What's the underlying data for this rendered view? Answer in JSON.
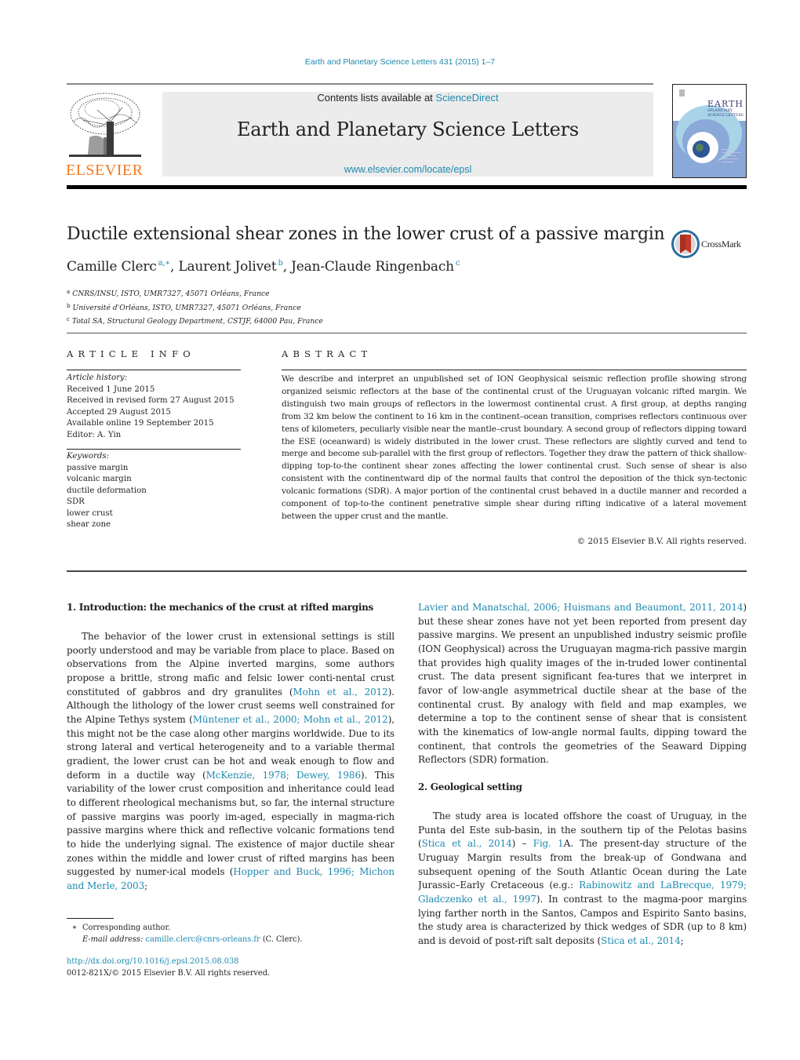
{
  "header": {
    "running_head": "Earth and Planetary Science Letters 431 (2015) 1–7",
    "contents_prefix": "Contents lists available at ",
    "contents_link": "ScienceDirect",
    "journal_title": "Earth and Planetary Science Letters",
    "journal_url": "www.elsevier.com/locate/epsl",
    "publisher_wordmark": "ELSEVIER",
    "cover_title_lines": [
      "EARTH",
      "SPLANETARY",
      "SCIENCE LETTERS"
    ]
  },
  "article": {
    "title": "Ductile extensional shear zones in the lower crust of a passive margin",
    "crossmark_label": "CrossMark",
    "authors": [
      {
        "name": "Camille Clerc",
        "sup": "a,∗"
      },
      {
        "name": "Laurent Jolivet",
        "sup": "b"
      },
      {
        "name": "Jean-Claude Ringenbach",
        "sup": "c"
      }
    ],
    "author_separator": ", ",
    "affiliations": [
      {
        "key": "a",
        "text": "CNRS/INSU, ISTO, UMR7327, 45071 Orléans, France"
      },
      {
        "key": "b",
        "text": "Université d'Orléans, ISTO, UMR7327, 45071 Orléans, France"
      },
      {
        "key": "c",
        "text": "Total SA, Structural Geology Department, CSTJF, 64000 Pau, France"
      }
    ]
  },
  "article_info": {
    "heading": "ARTICLE INFO",
    "history_label": "Article history:",
    "history": [
      "Received 1 June 2015",
      "Received in revised form 27 August 2015",
      "Accepted 29 August 2015",
      "Available online 19 September 2015",
      "Editor: A. Yin"
    ],
    "keywords_label": "Keywords:",
    "keywords": [
      "passive margin",
      "volcanic margin",
      "ductile deformation",
      "SDR",
      "lower crust",
      "shear zone"
    ]
  },
  "abstract": {
    "heading": "ABSTRACT",
    "text": "We describe and interpret an unpublished set of ION Geophysical seismic reflection profile showing strong organized seismic reflectors at the base of the continental crust of the Uruguayan volcanic rifted margin. We distinguish two main groups of reflectors in the lowermost continental crust. A first group, at depths ranging from 32 km below the continent to 16 km in the continent–ocean transition, comprises reflectors continuous over tens of kilometers, peculiarly visible near the mantle–crust boundary. A second group of reflectors dipping toward the ESE (oceanward) is widely distributed in the lower crust. These reflectors are slightly curved and tend to merge and become sub-parallel with the first group of reflectors. Together they draw the pattern of thick shallow-dipping top-to-the continent shear zones affecting the lower continental crust. Such sense of shear is also consistent with the continentward dip of the normal faults that control the deposition of the thick syn-tectonic volcanic formations (SDR). A major portion of the continental crust behaved in a ductile manner and recorded a component of top-to-the continent penetrative simple shear during rifting indicative of a lateral movement between the upper crust and the mantle.",
    "copyright": "© 2015 Elsevier B.V. All rights reserved."
  },
  "body": {
    "section1": {
      "heading": "1.  Introduction: the mechanics of the crust at rifted margins",
      "p1": [
        {
          "t": "The behavior of the lower crust in extensional settings is still poorly understood and may be variable from place to place. Based on observations from the Alpine inverted margins, some authors propose a brittle, strong mafic and felsic lower conti-nental crust constituted of gabbros and dry granulites ("
        },
        {
          "t": "Mohn et al., 2012",
          "link": true
        },
        {
          "t": "). Although the lithology of the lower crust seems well constrained for the Alpine Tethys system ("
        },
        {
          "t": "Müntener et al., 2000; Mohn et al., 2012",
          "link": true
        },
        {
          "t": "), this might not be the case along other margins worldwide. Due to its strong lateral and vertical heterogeneity and to a variable thermal gradient, the lower crust can be hot and weak enough to flow and deform in a ductile way ("
        },
        {
          "t": "McKenzie, 1978; Dewey, 1986",
          "link": true
        },
        {
          "t": "). This variability of the lower crust composition and inheritance could lead to different rheological mechanisms but, so far, the internal structure of passive margins was poorly im-aged, especially in magma-rich passive margins where thick and reflective volcanic formations tend to hide the underlying signal. The existence of major ductile shear zones within the middle and lower crust of rifted margins has been suggested by numer-ical models ("
        },
        {
          "t": "Hopper and Buck, 1996; Michon and Merle, 2003",
          "link": true
        },
        {
          "t": "; "
        },
        {
          "t": "Lavier and Manatschal, 2006; Huismans and Beaumont, 2011, 2014",
          "link": true
        },
        {
          "t": ") but these shear zones have not yet been reported from present day passive margins. We present an unpublished industry seismic profile (ION Geophysical) across the Uruguayan magma-rich passive margin that provides high quality images of the in-truded lower continental crust. The data present significant fea-tures that we interpret in favor of low-angle asymmetrical ductile shear at the base of the continental crust. By analogy with field and map examples, we determine a top to the continent sense of shear that is consistent with the kinematics of low-angle normal faults, dipping toward the continent, that controls the geometries of the Seaward Dipping Reflectors (SDR) formation."
        }
      ]
    },
    "section2": {
      "heading": "2.  Geological setting",
      "p1": [
        {
          "t": "The study area is located offshore the coast of Uruguay, in the Punta del Este sub-basin, in the southern tip of the Pelotas basins ("
        },
        {
          "t": "Stica et al., 2014",
          "link": true
        },
        {
          "t": ") – "
        },
        {
          "t": "Fig. 1",
          "link": true
        },
        {
          "t": "A. The present-day structure of the Uruguay Margin results from the break-up of Gondwana and subsequent opening of the South Atlantic Ocean during the Late Jurassic–Early Cretaceous (e.g.: "
        },
        {
          "t": "Rabinowitz and LaBrecque, 1979; Gladczenko et al., 1997",
          "link": true
        },
        {
          "t": "). In contrast to the magma-poor margins lying farther north in the Santos, Campos and Espirito Santo basins, the study area is characterized by thick wedges of SDR (up to 8 km) and is devoid of post-rift salt deposits ("
        },
        {
          "t": "Stica et al., 2014",
          "link": true
        },
        {
          "t": ";"
        }
      ]
    }
  },
  "footnote": {
    "star": "∗",
    "corresponding": "Corresponding author.",
    "email_label": "E-mail address: ",
    "email": "camille.clerc@cnrs-orleans.fr",
    "email_suffix": " (C. Clerc).",
    "doi": "http://dx.doi.org/10.1016/j.epsl.2015.08.038",
    "issn_line": "0012-821X/© 2015 Elsevier B.V. All rights reserved."
  },
  "colors": {
    "link": "#1f8ab0",
    "elsevier_orange": "#f47920",
    "masthead_bg": "#ececec",
    "text": "#231f20"
  }
}
